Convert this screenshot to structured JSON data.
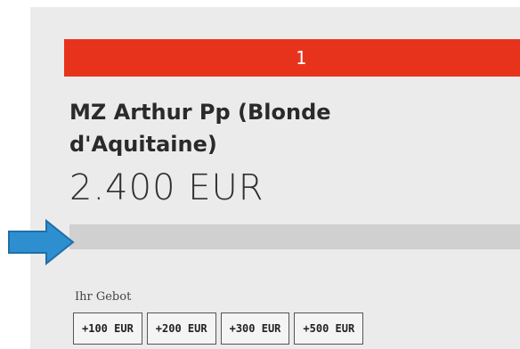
{
  "lot": {
    "number": "1"
  },
  "item": {
    "title": "MZ Arthur Pp (Blonde d'Aquitaine)",
    "price": "2.400 EUR"
  },
  "progress": {
    "fill_fraction": 0
  },
  "bid": {
    "label": "Ihr Gebot",
    "buttons": [
      "+100 EUR",
      "+200 EUR",
      "+300 EUR",
      "+500 EUR"
    ]
  },
  "colors": {
    "accent_red": "#e8331c",
    "arrow_blue": "#2e8fd0"
  },
  "icons": {
    "pointer": "blue-arrow-icon"
  }
}
